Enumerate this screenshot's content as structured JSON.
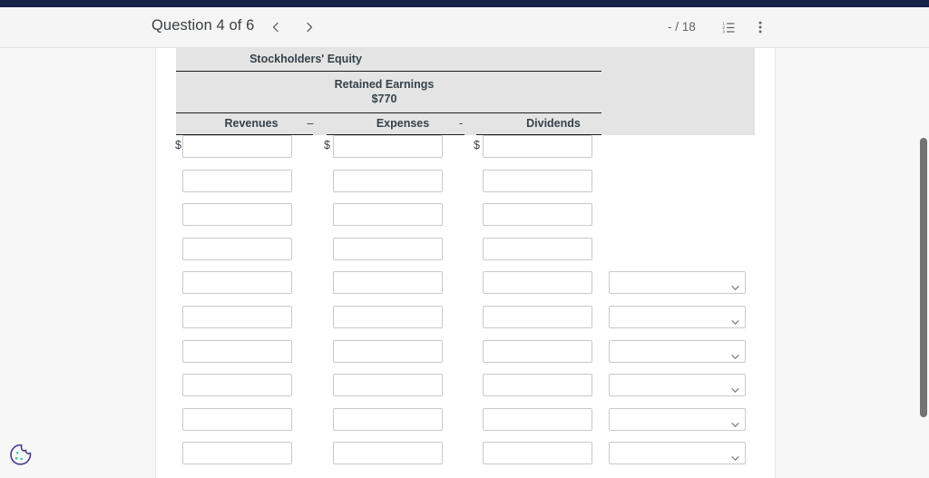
{
  "theme": {
    "navy": "#16224a",
    "header_bg": "#f5f5f5",
    "page_bg": "#f7f7f7",
    "sheet_bg": "#ffffff",
    "table_header_bg": "#e4e4e4",
    "text": "#35424b",
    "muted_text": "#5f6368",
    "input_border": "#c9c9c9",
    "scrollbar": "#737373",
    "cookie_outline": "#4a3b8c",
    "cookie_dots": "#3ec28f"
  },
  "header": {
    "title": "Question 4 of 6",
    "prev_label": "Previous question",
    "next_label": "Next question",
    "page_count": "- / 18",
    "list_icon": "numbered-list-icon",
    "more_icon": "more-vertical-icon",
    "prev_icon": "chevron-left-icon",
    "next_icon": "chevron-right-icon"
  },
  "table": {
    "section_title": "Stockholders' Equity",
    "account_title": "Retained Earnings",
    "account_balance": "$770",
    "columns": [
      {
        "key": "revenues",
        "label": "Revenues"
      },
      {
        "key": "expenses",
        "label": "Expenses"
      },
      {
        "key": "dividends",
        "label": "Dividends"
      }
    ],
    "operators": [
      "–",
      "-"
    ],
    "currency_symbol": "$",
    "first_row_currency": [
      "$",
      "$",
      "$"
    ],
    "rows": [
      {
        "revenues": "",
        "expenses": "",
        "dividends": "",
        "account": "",
        "has_currency": true,
        "has_select": false
      },
      {
        "revenues": "",
        "expenses": "",
        "dividends": "",
        "account": "",
        "has_currency": false,
        "has_select": false
      },
      {
        "revenues": "",
        "expenses": "",
        "dividends": "",
        "account": "",
        "has_currency": false,
        "has_select": false
      },
      {
        "revenues": "",
        "expenses": "",
        "dividends": "",
        "account": "",
        "has_currency": false,
        "has_select": false
      },
      {
        "revenues": "",
        "expenses": "",
        "dividends": "",
        "account": "",
        "has_currency": false,
        "has_select": true
      },
      {
        "revenues": "",
        "expenses": "",
        "dividends": "",
        "account": "",
        "has_currency": false,
        "has_select": true
      },
      {
        "revenues": "",
        "expenses": "",
        "dividends": "",
        "account": "",
        "has_currency": false,
        "has_select": true
      },
      {
        "revenues": "",
        "expenses": "",
        "dividends": "",
        "account": "",
        "has_currency": false,
        "has_select": true
      },
      {
        "revenues": "",
        "expenses": "",
        "dividends": "",
        "account": "",
        "has_currency": false,
        "has_select": true
      },
      {
        "revenues": "",
        "expenses": "",
        "dividends": "",
        "account": "",
        "has_currency": false,
        "has_select": true
      }
    ],
    "input_placeholder": "",
    "select_placeholder": ""
  },
  "scrollbar": {
    "orientation": "vertical",
    "name": "page-scrollbar"
  },
  "cookie": {
    "icon": "cookie-icon",
    "label": "Cookie preferences"
  }
}
